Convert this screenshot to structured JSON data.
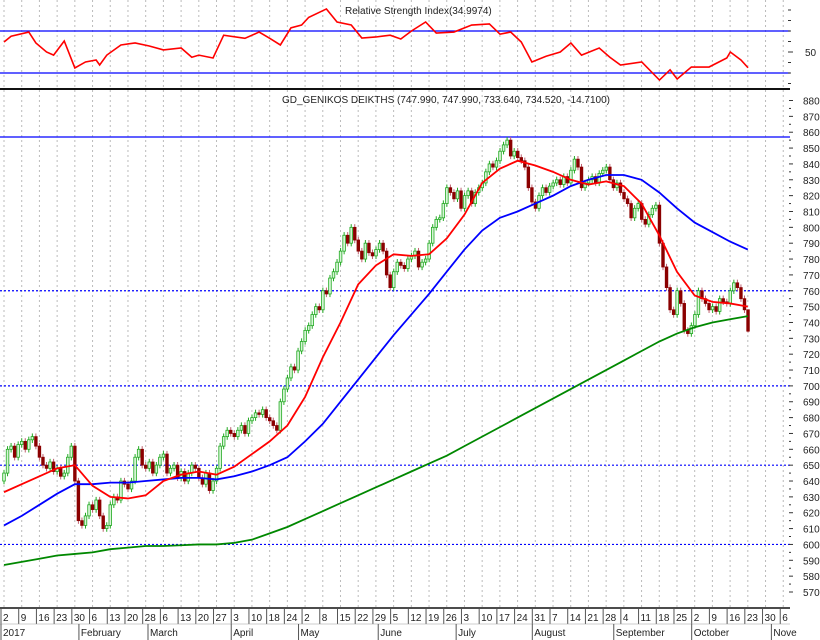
{
  "chart_data": [
    {
      "type": "line",
      "title": "Relative Strength Index(34.9974)",
      "ylim": [
        10,
        95
      ],
      "reference_lines": [
        70,
        30
      ],
      "y_tick_labels": [
        "50"
      ],
      "colors": {
        "line": "#ff0000",
        "reference": "#0000ff"
      },
      "points": [
        [
          0,
          59.5
        ],
        [
          2,
          65
        ],
        [
          7,
          69
        ],
        [
          9,
          58.6
        ],
        [
          12,
          50
        ],
        [
          14,
          47
        ],
        [
          17,
          60.5
        ],
        [
          20,
          34.8
        ],
        [
          23,
          40.5
        ],
        [
          26,
          42.4
        ],
        [
          27,
          37.6
        ],
        [
          29,
          47
        ],
        [
          33,
          56.7
        ],
        [
          37,
          58.6
        ],
        [
          41,
          55.7
        ],
        [
          45,
          52
        ],
        [
          50,
          53.8
        ],
        [
          53,
          45
        ],
        [
          55,
          47
        ],
        [
          59,
          44.3
        ],
        [
          62,
          66
        ],
        [
          68,
          63
        ],
        [
          72,
          69
        ],
        [
          75,
          63
        ],
        [
          78,
          56.7
        ],
        [
          81,
          73
        ],
        [
          84,
          75.7
        ],
        [
          86,
          83
        ],
        [
          91,
          91
        ],
        [
          94,
          78.6
        ],
        [
          98,
          75.7
        ],
        [
          101,
          63.3
        ],
        [
          105,
          64.3
        ],
        [
          109,
          66
        ],
        [
          112,
          62.4
        ],
        [
          115,
          70
        ],
        [
          119,
          78.6
        ],
        [
          122,
          68
        ],
        [
          127,
          69
        ],
        [
          132,
          75.7
        ],
        [
          137,
          76.7
        ],
        [
          140,
          67
        ],
        [
          143,
          69
        ],
        [
          146,
          59.5
        ],
        [
          149,
          40.5
        ],
        [
          153,
          46
        ],
        [
          157,
          50
        ],
        [
          160,
          58.6
        ],
        [
          163,
          47
        ],
        [
          168,
          53.8
        ],
        [
          171,
          45
        ],
        [
          174,
          37.6
        ],
        [
          180,
          40.5
        ],
        [
          185,
          23.3
        ],
        [
          188,
          33
        ],
        [
          190,
          24.3
        ],
        [
          194,
          35.7
        ],
        [
          199,
          35.7
        ],
        [
          204,
          44.3
        ],
        [
          205,
          50
        ],
        [
          208,
          42.4
        ],
        [
          210,
          35
        ]
      ]
    },
    {
      "type": "candlestick",
      "title": "GD_GENIKOS DEIKTHS (747.990, 747.990, 733.640, 734.520, -14.7100)",
      "ylim": [
        565,
        885
      ],
      "y_tick_labels": [
        "880",
        "870",
        "860",
        "850",
        "840",
        "830",
        "820",
        "810",
        "800",
        "790",
        "780",
        "770",
        "760",
        "750",
        "740",
        "730",
        "720",
        "710",
        "700",
        "690",
        "680",
        "670",
        "660",
        "650",
        "640",
        "630",
        "620",
        "610",
        "600",
        "590",
        "580",
        "570"
      ],
      "solid_lines": [
        857
      ],
      "dotted_lines": [
        760,
        700,
        650,
        600
      ],
      "colors": {
        "up": "#22aa22",
        "up_fill": "#d6f5d6",
        "down": "#8b0000",
        "ma_fast": "#ff0000",
        "ma_mid": "#0000ff",
        "ma_slow": "#008800",
        "hline": "#0000ff"
      },
      "weekly_daily_closes": [
        [
          645,
          660,
          662,
          655,
          663
        ],
        [
          665,
          660,
          666,
          668,
          662
        ],
        [
          655,
          650,
          648,
          652,
          646
        ],
        [
          648,
          643,
          645,
          655,
          662
        ],
        [
          640,
          615,
          612,
          618,
          625
        ],
        [
          622,
          628,
          618,
          610,
          612
        ],
        [
          625,
          630,
          628,
          640,
          638
        ],
        [
          635,
          640,
          655,
          660,
          650
        ],
        [
          648,
          652,
          645,
          650,
          655
        ],
        [
          657,
          645,
          648,
          650,
          642
        ],
        [
          646,
          640,
          645,
          650,
          648
        ],
        [
          642,
          638,
          645,
          634,
          640
        ],
        [
          648,
          662,
          668,
          672,
          670
        ],
        [
          668,
          672,
          675,
          670,
          678
        ],
        [
          680,
          683,
          682,
          685,
          680
        ],
        [
          678,
          675,
          672,
          690,
          698
        ],
        [
          705,
          712,
          710,
          722,
          728
        ],
        [
          735,
          738,
          745,
          750,
          748
        ],
        [
          760,
          758,
          768,
          772,
          778
        ],
        [
          785,
          795,
          790,
          800,
          792
        ],
        [
          785,
          780,
          790,
          784,
          782
        ],
        [
          786,
          790,
          785,
          770,
          762
        ],
        [
          772,
          778,
          776,
          774,
          780
        ],
        [
          782,
          785,
          775,
          778,
          780
        ],
        [
          790,
          800,
          805,
          806,
          815
        ],
        [
          825,
          822,
          818,
          823,
          812
        ],
        [
          820,
          823,
          815,
          822,
          825
        ],
        [
          828,
          835,
          840,
          838,
          842
        ],
        [
          848,
          852,
          855,
          845,
          848
        ],
        [
          844,
          842,
          838,
          825,
          816
        ],
        [
          812,
          820,
          825,
          822,
          826
        ],
        [
          828,
          830,
          827,
          832,
          828
        ],
        [
          836,
          843,
          838,
          825,
          828
        ],
        [
          830,
          832,
          828,
          834,
          836
        ],
        [
          838,
          830,
          825,
          828,
          822
        ],
        [
          818,
          815,
          806,
          812,
          815
        ],
        [
          805,
          802,
          808,
          812,
          814
        ],
        [
          790,
          775,
          762,
          748,
          745
        ],
        [
          760,
          752,
          735,
          733,
          738
        ],
        [
          745,
          760,
          755,
          752,
          748
        ],
        [
          750,
          747,
          755,
          753,
          752
        ],
        [
          760,
          765,
          762,
          755,
          748
        ]
      ],
      "last_candle": {
        "open": 747.99,
        "high": 747.99,
        "low": 733.64,
        "close": 734.52,
        "change": -14.71
      },
      "ma_fast_weekly": [
        633,
        638,
        643,
        648,
        650,
        637,
        630,
        629,
        631,
        640,
        644,
        646,
        644,
        649,
        657,
        665,
        675,
        693,
        718,
        740,
        764,
        776,
        783,
        782,
        783,
        793,
        808,
        828,
        837,
        842,
        839,
        835,
        830,
        827,
        829,
        826,
        815,
        795,
        772,
        757,
        753,
        752,
        750
      ],
      "ma_mid_weekly": [
        612,
        618,
        625,
        632,
        638,
        638,
        639,
        639,
        640,
        641,
        642,
        642,
        641,
        643,
        646,
        650,
        655,
        665,
        676,
        690,
        704,
        718,
        732,
        745,
        758,
        772,
        786,
        798,
        806,
        810,
        815,
        820,
        826,
        830,
        833,
        833,
        830,
        822,
        812,
        803,
        797,
        791,
        786
      ],
      "ma_slow_weekly": [
        587,
        589,
        591,
        593,
        594,
        595,
        597,
        598,
        599,
        599,
        599.5,
        600,
        600,
        601,
        603,
        607,
        611,
        616,
        621,
        626,
        631,
        636,
        641,
        646,
        651,
        656,
        662,
        668,
        674,
        680,
        686,
        692,
        698,
        704,
        710,
        716,
        722,
        728,
        733,
        737,
        740,
        742,
        744
      ],
      "x_day_labels": [
        "2",
        "9",
        "16",
        "23",
        "30",
        "6",
        "13",
        "20",
        "28",
        "6",
        "13",
        "20",
        "27",
        "3",
        "10",
        "18",
        "24",
        "2",
        "8",
        "15",
        "22",
        "29",
        "5",
        "12",
        "19",
        "26",
        "3",
        "10",
        "17",
        "24",
        "31",
        "7",
        "14",
        "21",
        "28",
        "4",
        "11",
        "18",
        "25",
        "2",
        "9",
        "16",
        "23",
        "30",
        "6"
      ],
      "x_month_labels": [
        {
          "label": "2017",
          "week": 0
        },
        {
          "label": "February",
          "week": 4.4
        },
        {
          "label": "March",
          "week": 8.3
        },
        {
          "label": "April",
          "week": 13
        },
        {
          "label": "May",
          "week": 16.8
        },
        {
          "label": "June",
          "week": 21.3
        },
        {
          "label": "July",
          "week": 25.7
        },
        {
          "label": "August",
          "week": 30
        },
        {
          "label": "September",
          "week": 34.6
        },
        {
          "label": "October",
          "week": 39
        },
        {
          "label": "Nove",
          "week": 43.5
        }
      ]
    }
  ]
}
